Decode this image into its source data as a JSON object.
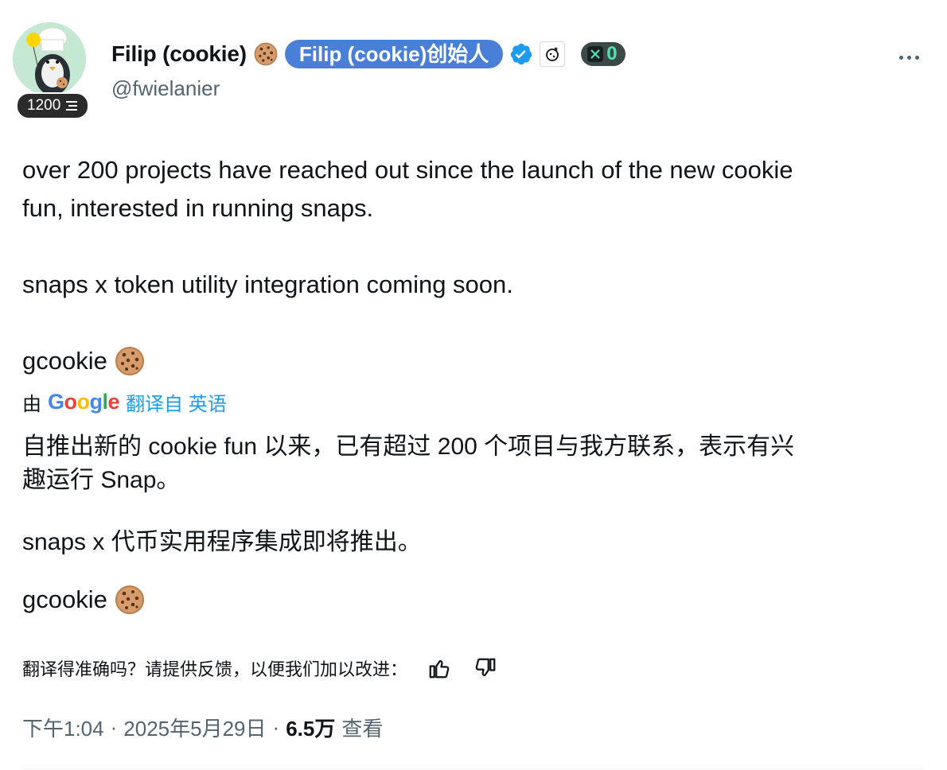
{
  "author": {
    "display_name": "Filip (cookie)",
    "affiliation": "Filip (cookie)创始人",
    "handle": "@fwielanier",
    "level": "1200",
    "x_count": "0"
  },
  "tweet": {
    "lines_en": [
      "over 200 projects have reached out since the launch of the new cookie",
      "fun, interested in running snaps.",
      "snaps x token utility integration coming soon.",
      "gcookie"
    ],
    "translation_prefix": "由",
    "translation_provider": "Google",
    "translation_link": "翻译自 英语",
    "lines_zh": [
      "自推出新的 cookie fun 以来，已有超过 200 个项目与我方联系，表示有兴",
      "趣运行 Snap。",
      "snaps x 代币实用程序集成即将推出。",
      "gcookie"
    ]
  },
  "feedback": {
    "prompt": "翻译得准确吗？请提供反馈，以便我们加以改进："
  },
  "meta": {
    "time": "下午1:04",
    "sep1": "·",
    "date": "2025年5月29日",
    "sep2": "·",
    "views": "6.5万",
    "views_label": "查看"
  },
  "icons": {
    "cookie": "cookie-emoji",
    "verified": "verified-badge-icon",
    "more": "more-icon",
    "thumbs_up": "thumbs-up-icon",
    "thumbs_down": "thumbs-down-icon"
  },
  "colors": {
    "link": "#1d9bf0",
    "affiliation_badge": "#4a7fd8",
    "muted": "#536471"
  }
}
